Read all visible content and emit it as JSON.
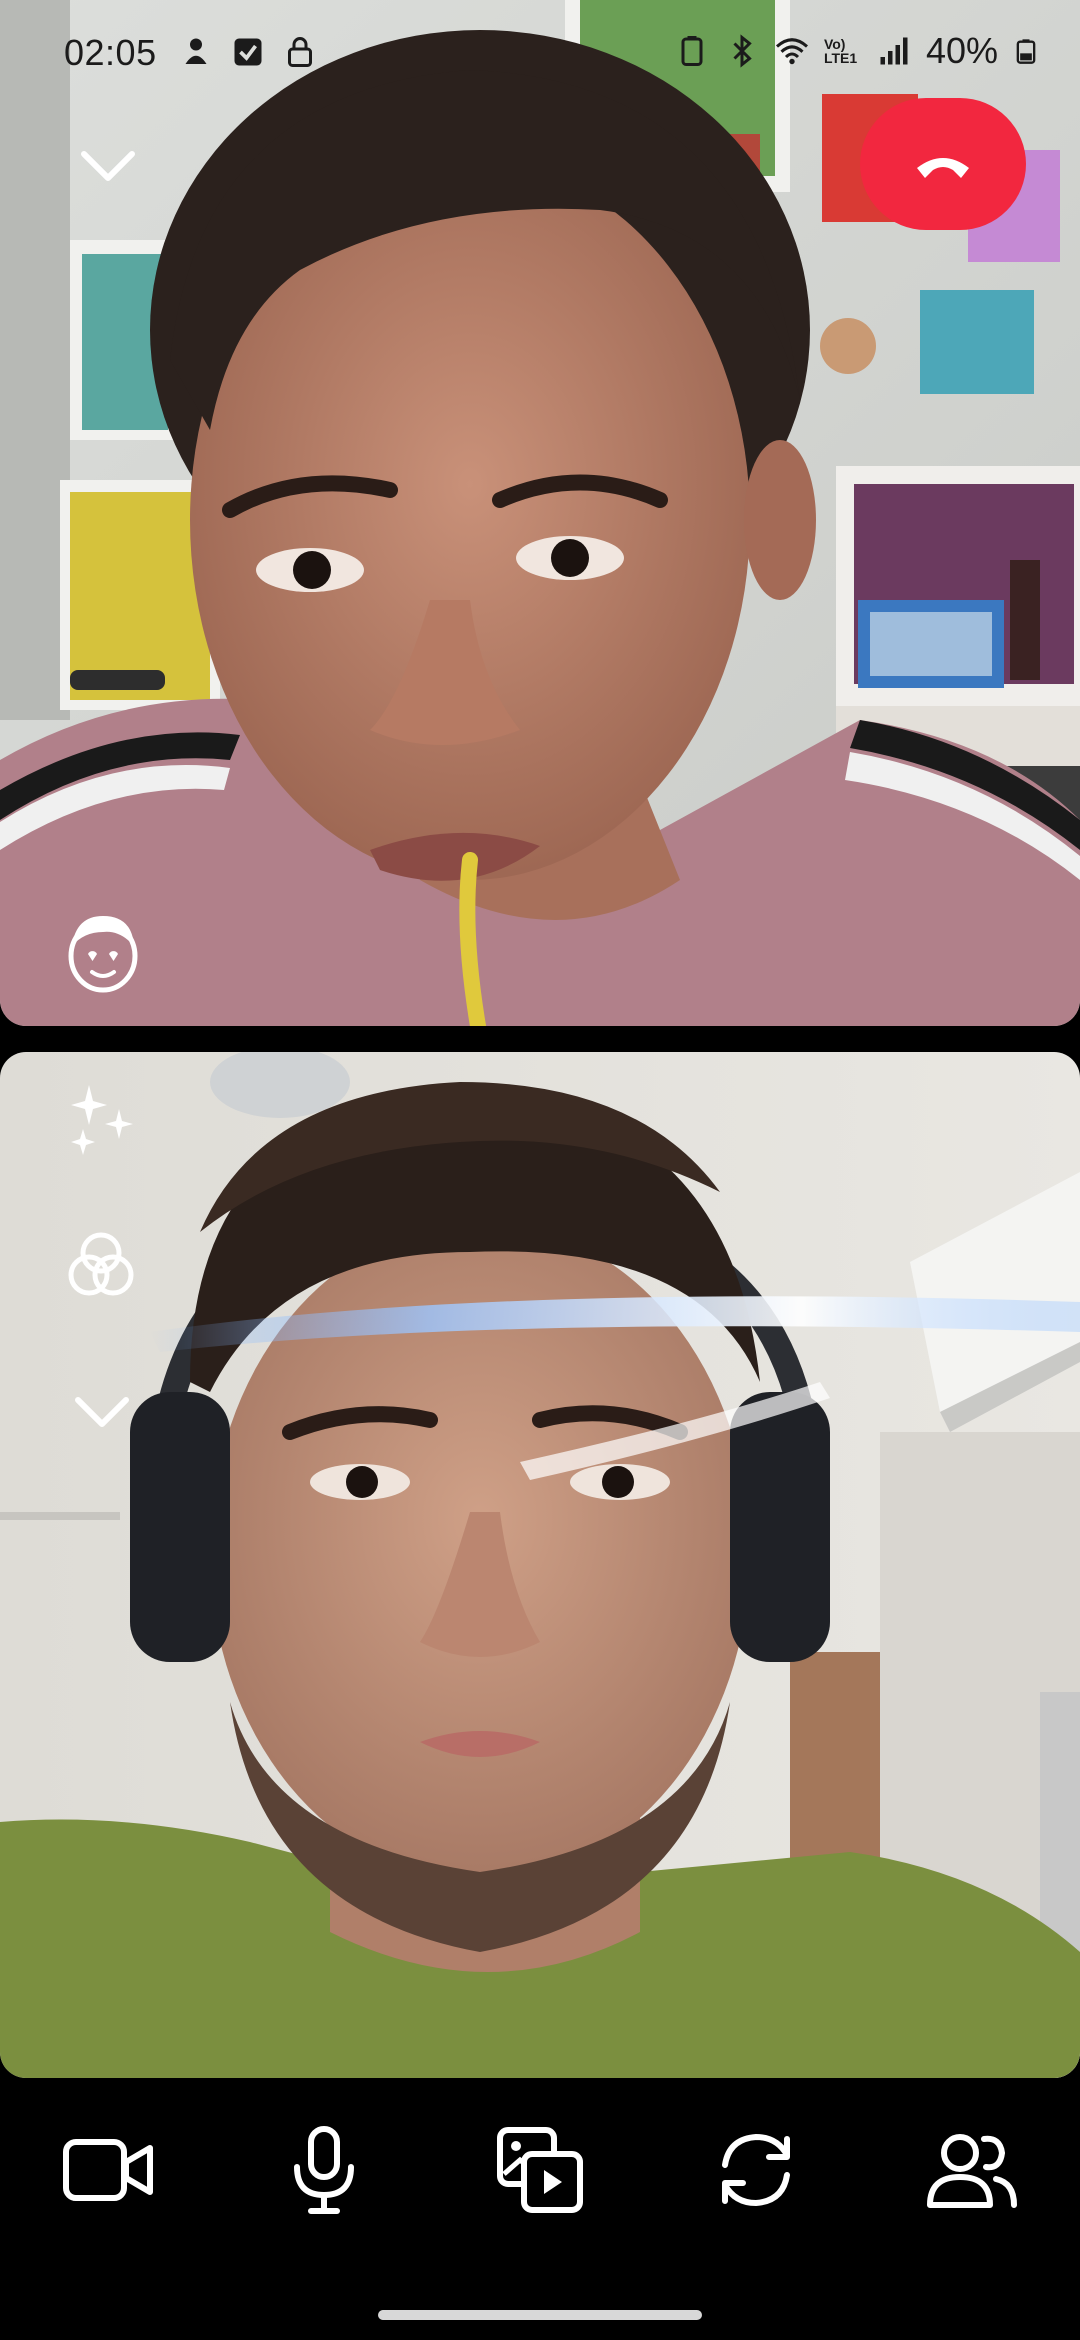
{
  "status_bar": {
    "time": "02:05",
    "battery_percent": "40%",
    "network_label": "Vo) LTE1"
  },
  "call": {
    "remote_participant_present": true,
    "self_view_present": true
  },
  "top_controls": {
    "collapse_icon": "chevron-down-icon",
    "end_call_icon": "phone-hangup-icon",
    "end_call_color": "#f2273f",
    "lens_icon": "face-lens-icon"
  },
  "side_controls": {
    "items": [
      "sparkles-icon",
      "color-filter-icon",
      "chevron-down-icon"
    ]
  },
  "bottom_bar": {
    "buttons": [
      "video-camera-icon",
      "microphone-icon",
      "media-share-icon",
      "flip-camera-icon",
      "participants-icon"
    ]
  }
}
